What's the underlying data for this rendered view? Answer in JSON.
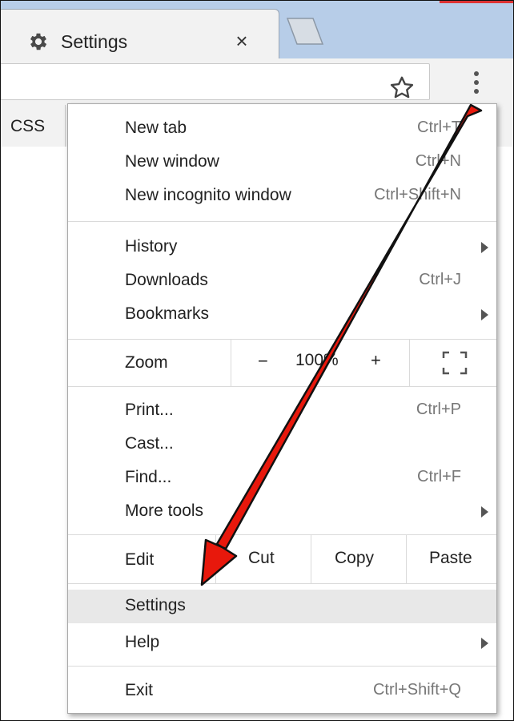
{
  "tab": {
    "title": "Settings",
    "close_glyph": "×"
  },
  "bookmarks": {
    "items": [
      "CSS"
    ]
  },
  "menu": {
    "group1": [
      {
        "label": "New tab",
        "shortcut": "Ctrl+T"
      },
      {
        "label": "New window",
        "shortcut": "Ctrl+N"
      },
      {
        "label": "New incognito window",
        "shortcut": "Ctrl+Shift+N"
      }
    ],
    "group2": [
      {
        "label": "History",
        "shortcut": ""
      },
      {
        "label": "Downloads",
        "shortcut": "Ctrl+J"
      },
      {
        "label": "Bookmarks",
        "shortcut": ""
      }
    ],
    "zoom": {
      "label": "Zoom",
      "minus": "−",
      "value": "100%",
      "plus": "+"
    },
    "group3": [
      {
        "label": "Print...",
        "shortcut": "Ctrl+P"
      },
      {
        "label": "Cast...",
        "shortcut": ""
      },
      {
        "label": "Find...",
        "shortcut": "Ctrl+F"
      },
      {
        "label": "More tools",
        "shortcut": ""
      }
    ],
    "edit": {
      "label": "Edit",
      "cut": "Cut",
      "copy": "Copy",
      "paste": "Paste"
    },
    "group4": [
      {
        "label": "Settings",
        "shortcut": ""
      },
      {
        "label": "Help",
        "shortcut": ""
      }
    ],
    "exit": {
      "label": "Exit",
      "shortcut": "Ctrl+Shift+Q"
    }
  },
  "icons": {
    "settings_tab": "gear-icon",
    "bookmark_star": "star-icon",
    "menu": "kebab-menu-icon",
    "fullscreen": "fullscreen-icon",
    "submenu": "chevron-right-icon",
    "annotation": "red-arrow-icon"
  },
  "colors": {
    "arrow": "#e8180c",
    "highlight": "#e8e8e8",
    "tabstrip": "#b7cde8"
  }
}
